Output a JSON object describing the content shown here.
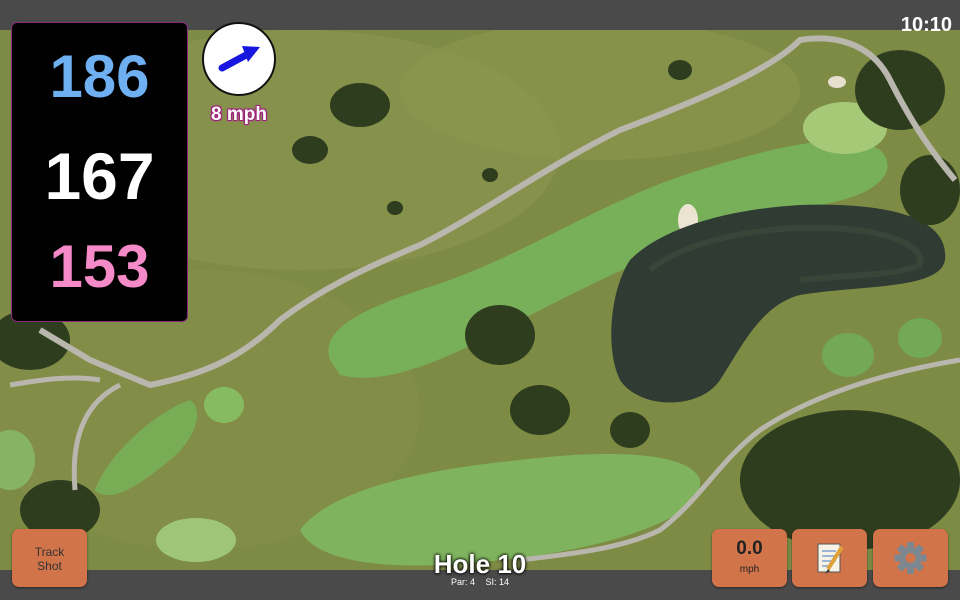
{
  "status": {
    "time": "10:10"
  },
  "yardages": {
    "back": "186",
    "middle": "167",
    "front": "153"
  },
  "wind": {
    "speed": "8 mph",
    "arrow_icon": "arrow-right-up-icon"
  },
  "buttons": {
    "track_shot": {
      "line1": "Track",
      "line2": "Shot"
    },
    "speed": {
      "value": "0.0",
      "unit": "mph"
    },
    "notes_icon": "notepad-icon",
    "settings_icon": "gear-icon"
  },
  "hole": {
    "title": "Hole 10",
    "par": "Par: 4",
    "si": "SI: 14"
  },
  "colors": {
    "back": "#6fb0f2",
    "middle": "#ffffff",
    "front": "#f48bc8",
    "button": "#d2744a",
    "wind_text_outline": "#a0207f"
  }
}
